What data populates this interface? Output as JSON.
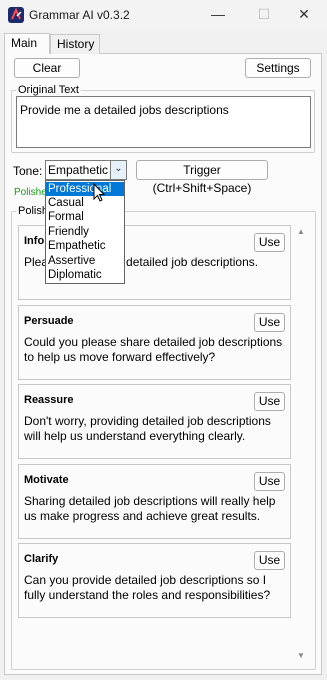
{
  "window": {
    "title": "Grammar AI v0.3.2",
    "minimize": "—",
    "maximize": "☐",
    "close": "✕",
    "icon": "app-icon"
  },
  "tabs": [
    {
      "label": "Main",
      "selected": true
    },
    {
      "label": "History",
      "selected": false
    }
  ],
  "toolbar": {
    "clear_label": "Clear",
    "settings_label": "Settings"
  },
  "original": {
    "group_label": "Original Text",
    "value": "Provide me a detailed jobs descriptions"
  },
  "tone": {
    "label": "Tone:",
    "selected": "Empathetic",
    "arrow": "⌄",
    "options": [
      "Professional",
      "Casual",
      "Formal",
      "Friendly",
      "Empathetic",
      "Assertive",
      "Diplomatic"
    ],
    "highlighted": "Professional"
  },
  "trigger_label": "Trigger (Ctrl+Shift+Space)",
  "status": "Polishe",
  "polished": {
    "group_label": "Polish",
    "cards": [
      {
        "title": "Info",
        "text": "Plea                with detailed job descriptions.",
        "use": "Use"
      },
      {
        "title": "Persuade",
        "text": "Could you please share detailed job descriptions to help us move forward effectively?",
        "use": "Use"
      },
      {
        "title": "Reassure",
        "text": "Don't worry, providing detailed job descriptions will help us understand everything clearly.",
        "use": "Use"
      },
      {
        "title": "Motivate",
        "text": "Sharing detailed job descriptions will really help us make progress and achieve great results.",
        "use": "Use"
      },
      {
        "title": "Clarify",
        "text": "Can you provide detailed job descriptions so I fully understand the roles and responsibilities?",
        "use": "Use"
      }
    ]
  },
  "scrollbar": {
    "up": "▲",
    "down": "▼"
  },
  "colors": {
    "accent": "#0078d7",
    "status": "#1a9c1a"
  }
}
